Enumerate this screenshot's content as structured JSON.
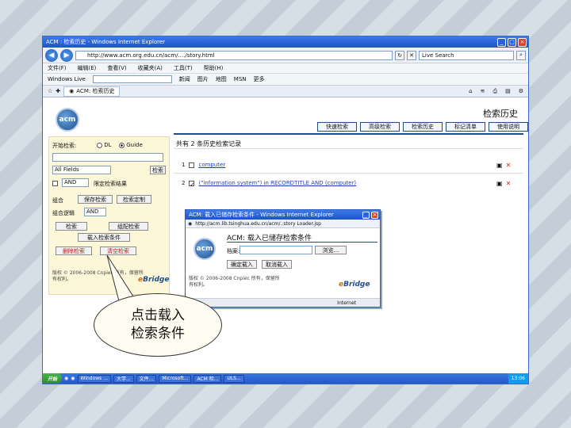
{
  "browser": {
    "title": "ACM : 检索历史 - Windows Internet Explorer",
    "url": "http://www.acm.org.edu.cn/acm/..../story.html",
    "search_placeholder": "Live Search",
    "menu": [
      "文件(F)",
      "编辑(E)",
      "查看(V)",
      "收藏夹(A)",
      "工具(T)",
      "帮助(H)"
    ],
    "links_label": "Windows Live",
    "links": [
      "新闻",
      "图片",
      "地图",
      "MSN",
      "更多"
    ],
    "tab_label": "ACM: 检索历史"
  },
  "page": {
    "logo_text": "acm",
    "title": "检索历史",
    "nav_tabs": [
      "快速检索",
      "高级检索",
      "检索历史",
      "标记清单",
      "使用说明"
    ]
  },
  "sidebar": {
    "search_label": "开始检索:",
    "radio_dl": "DL",
    "radio_guide": "Guide",
    "field_value": "All Fields",
    "search_button": "检索",
    "and_value": "AND",
    "limit_label": "限定检索结果",
    "combine_label": "组合",
    "save_search_btn": "保存检索",
    "load_search_btn": "检索定制",
    "op_label": "组合逻辑",
    "op_value": "AND",
    "btn_search": "检索",
    "btn_combine": "组配检索",
    "btn_load": "载入检索条件",
    "btn_delete": "删除检索",
    "btn_clear": "清空检索",
    "copyright": "版权 © 2006-2008 Cnpiec 所有，保留所有权利。"
  },
  "history": {
    "title": "共有 2 条历史检索记录",
    "items": [
      {
        "num": "1",
        "query": "computer"
      },
      {
        "num": "2",
        "query": "(\"information system\") in RECORDTITLE AND (computer)"
      }
    ]
  },
  "popup": {
    "title": "ACM: 载入已储存检索条件 - Windows Internet Explorer",
    "url": "http://acm.lib.tsinghua.edu.cn/acm/..story Loader.jsp",
    "heading": "ACM: 载入已储存检索条件",
    "file_label": "档案:",
    "browse_btn": "浏览...",
    "confirm_btn": "确定载入",
    "cancel_btn": "取消载入",
    "copyright": "版权 © 2006-2008 Cnpiec 所有，保留所有权利。",
    "status": "Internet"
  },
  "brand": {
    "e": "e",
    "rest": "Bridge"
  },
  "callout": {
    "line1": "点击载入",
    "line2": "检索条件"
  },
  "taskbar": {
    "start": "开始",
    "tasks": [
      "Windows ...",
      "大学...",
      "文件...",
      "Microsoft...",
      "ACM 检...",
      "ULS..."
    ],
    "clock": "13:06"
  }
}
